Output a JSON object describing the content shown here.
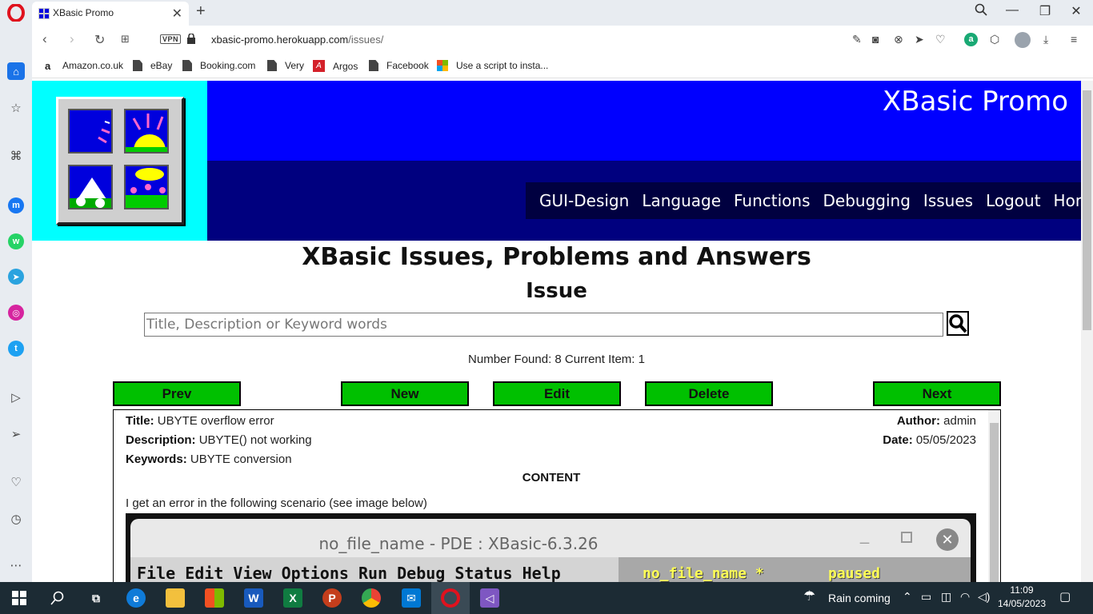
{
  "browser": {
    "tab_title": "XBasic Promo",
    "url_host": "xbasic-promo.herokuapp.com",
    "url_path": "/issues/",
    "vpn_label": "VPN",
    "bookmarks": [
      "Amazon.co.uk",
      "eBay",
      "Booking.com",
      "Very",
      "Argos",
      "Facebook",
      "Use a script to insta..."
    ]
  },
  "site": {
    "title": "XBasic Promo",
    "nav": [
      "GUI-Design",
      "Language",
      "Functions",
      "Debugging",
      "Issues",
      "Logout",
      "Home"
    ]
  },
  "main": {
    "heading": "XBasic Issues, Problems and Answers",
    "subheading": "Issue",
    "search_placeholder": "Title, Description or Keyword words",
    "found_text": "Number Found: 8 Current Item: 1",
    "buttons": {
      "prev": "Prev",
      "new": "New",
      "edit": "Edit",
      "delete": "Delete",
      "next": "Next"
    }
  },
  "issue": {
    "title_label": "Title:",
    "title": "UBYTE overflow error",
    "description_label": "Description:",
    "description": "UBYTE() not working",
    "keywords_label": "Keywords:",
    "keywords": "UBYTE conversion",
    "author_label": "Author:",
    "author": "admin",
    "date_label": "Date:",
    "date": "05/05/2023",
    "content_label": "CONTENT",
    "content_text": "I get an error in the following scenario (see image below)"
  },
  "embedded_screenshot": {
    "window_title": "no_file_name  -  PDE : XBasic-6.3.26",
    "menu": "File Edit View Options Run Debug Status Help",
    "file_name": "no_file_name *",
    "status": "paused"
  },
  "taskbar": {
    "weather": "Rain coming",
    "time": "11:09",
    "date": "14/05/2023"
  },
  "colors": {
    "header_bright": "#0000ff",
    "header_dark": "#00007f",
    "logo_bg": "#00ffff",
    "action_button": "#00c000"
  }
}
